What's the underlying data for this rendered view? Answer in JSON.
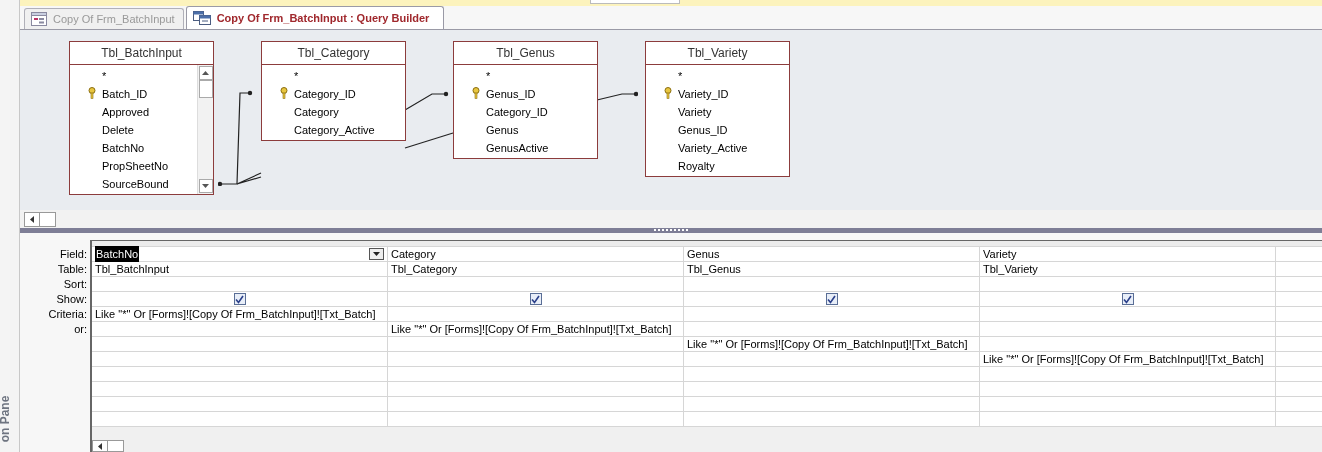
{
  "tabs": [
    {
      "label": "Copy Of Frm_BatchInput",
      "kind": "form",
      "selected": false
    },
    {
      "label": "Copy Of Frm_BatchInput : Query Builder",
      "kind": "query",
      "selected": true
    }
  ],
  "navigation_pane": {
    "label": "on Pane"
  },
  "tables": [
    {
      "title": "Tbl_BatchInput",
      "scrollable": true,
      "fields": [
        {
          "name": "*",
          "primary_key": false
        },
        {
          "name": "Batch_ID",
          "primary_key": true
        },
        {
          "name": "Approved",
          "primary_key": false
        },
        {
          "name": "Delete",
          "primary_key": false
        },
        {
          "name": "BatchNo",
          "primary_key": false
        },
        {
          "name": "PropSheetNo",
          "primary_key": false
        },
        {
          "name": "SourceBound",
          "primary_key": false
        }
      ]
    },
    {
      "title": "Tbl_Category",
      "scrollable": false,
      "fields": [
        {
          "name": "*",
          "primary_key": false
        },
        {
          "name": "Category_ID",
          "primary_key": true
        },
        {
          "name": "Category",
          "primary_key": false
        },
        {
          "name": "Category_Active",
          "primary_key": false
        }
      ]
    },
    {
      "title": "Tbl_Genus",
      "scrollable": false,
      "fields": [
        {
          "name": "*",
          "primary_key": false
        },
        {
          "name": "Genus_ID",
          "primary_key": true
        },
        {
          "name": "Category_ID",
          "primary_key": false
        },
        {
          "name": "Genus",
          "primary_key": false
        },
        {
          "name": "GenusActive",
          "primary_key": false
        }
      ]
    },
    {
      "title": "Tbl_Variety",
      "scrollable": false,
      "fields": [
        {
          "name": "*",
          "primary_key": false
        },
        {
          "name": "Variety_ID",
          "primary_key": true
        },
        {
          "name": "Variety",
          "primary_key": false
        },
        {
          "name": "Genus_ID",
          "primary_key": false
        },
        {
          "name": "Variety_Active",
          "primary_key": false
        },
        {
          "name": "Royalty",
          "primary_key": false
        }
      ]
    }
  ],
  "grid": {
    "row_labels": [
      "Field:",
      "Table:",
      "Sort:",
      "Show:",
      "Criteria:",
      "or:"
    ],
    "columns": [
      {
        "field": "BatchNo",
        "selected": true,
        "table": "Tbl_BatchInput",
        "show": true,
        "criteria": {
          "kind": "criteria",
          "text": "Like \"*\" Or [Forms]![Copy Of Frm_BatchInput]![Txt_Batch]"
        }
      },
      {
        "field": "Category",
        "selected": false,
        "table": "Tbl_Category",
        "show": true,
        "criteria": {
          "kind": "or",
          "text": "Like \"*\" Or [Forms]![Copy Of Frm_BatchInput]![Txt_Batch]"
        }
      },
      {
        "field": "Genus",
        "selected": false,
        "table": "Tbl_Genus",
        "show": true,
        "criteria": {
          "kind": "or_2",
          "text": "Like \"*\" Or [Forms]![Copy Of Frm_BatchInput]![Txt_Batch]"
        }
      },
      {
        "field": "Variety",
        "selected": false,
        "table": "Tbl_Variety",
        "show": true,
        "criteria": {
          "kind": "or_3",
          "text": "Like \"*\" Or [Forms]![Copy Of Frm_BatchInput]![Txt_Batch]"
        }
      }
    ]
  }
}
